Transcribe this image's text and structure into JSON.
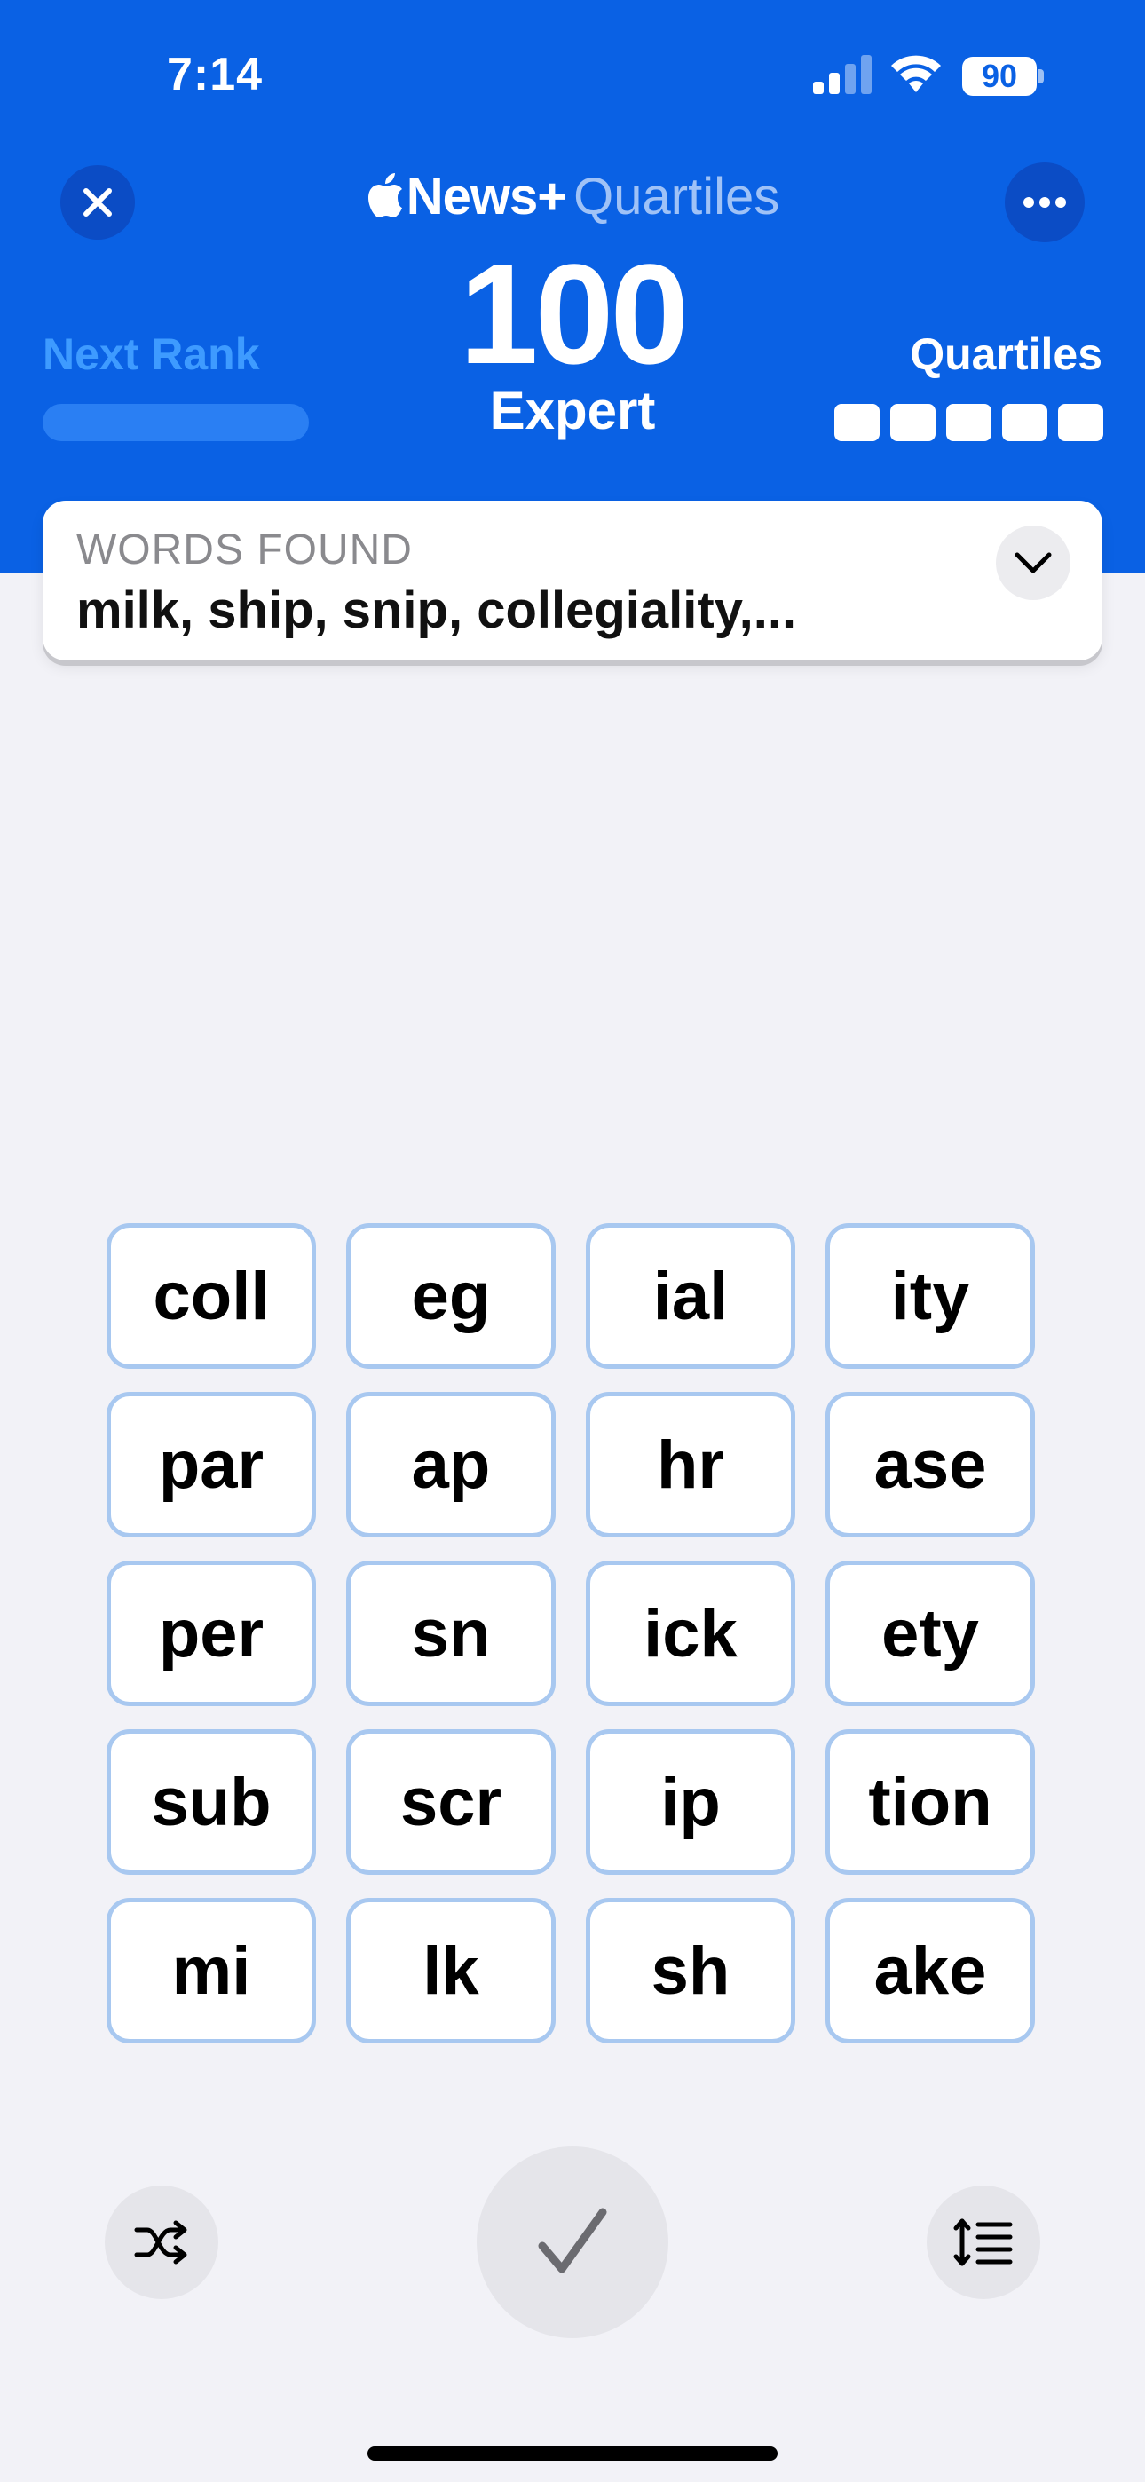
{
  "status_bar": {
    "time": "7:14",
    "battery": "90",
    "icons": [
      "cellular-signal-icon",
      "wifi-icon",
      "battery-icon"
    ]
  },
  "header": {
    "brand_news": "News+",
    "brand_game": "Quartiles",
    "score": "100",
    "rank": "Expert",
    "next_rank_label": "Next Rank",
    "next_rank_progress": 0,
    "quartiles_label": "Quartiles",
    "quartiles_found": 5,
    "quartiles_total": 5,
    "close_icon": "close-icon",
    "more_icon": "more-icon"
  },
  "words_found": {
    "label": "WORDS FOUND",
    "value": "milk, ship, snip, collegiality,...",
    "expand_icon": "chevron-down-icon"
  },
  "tiles": [
    [
      "coll",
      "eg",
      "ial",
      "ity"
    ],
    [
      "par",
      "ap",
      "hr",
      "ase"
    ],
    [
      "per",
      "sn",
      "ick",
      "ety"
    ],
    [
      "sub",
      "scr",
      "ip",
      "tion"
    ],
    [
      "mi",
      "lk",
      "sh",
      "ake"
    ]
  ],
  "controls": {
    "shuffle_icon": "shuffle-icon",
    "submit_icon": "checkmark-icon",
    "sort_icon": "sort-list-icon"
  },
  "colors": {
    "header_blue": "#0A61E4",
    "tile_border": "#A8C8F0",
    "background": "#F2F2F7"
  }
}
